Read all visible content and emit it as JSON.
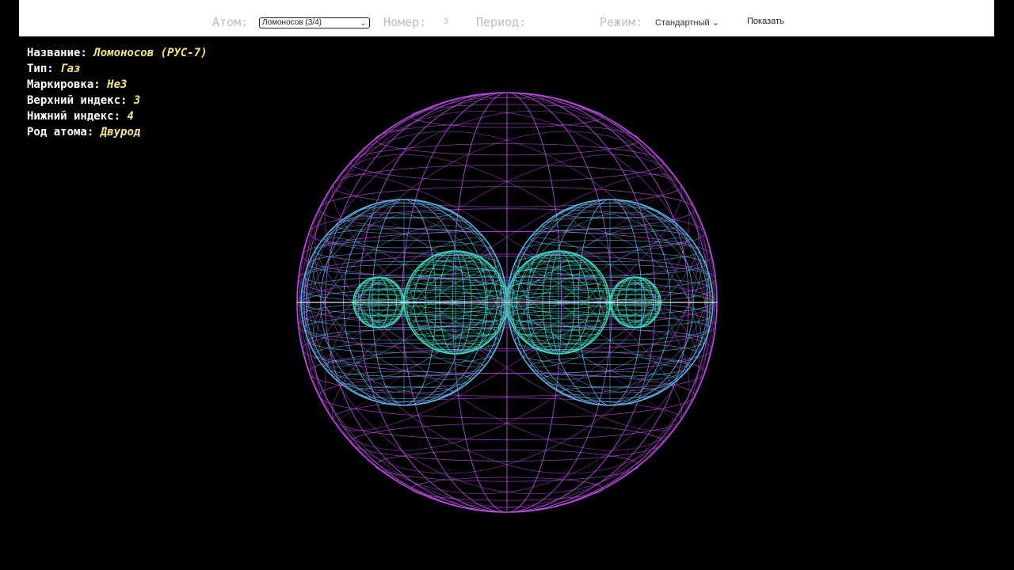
{
  "toolbar": {
    "atom_label": "Атом:",
    "atom_select_value": "Ломоносов (3/4)",
    "number_label": "Номер:",
    "number_value": "3",
    "period_label": "Период:",
    "mode_label": "Режим:",
    "mode_value": "Стандартный",
    "show_button": "Показать"
  },
  "info": {
    "name_label": "Название:",
    "name_value": "Ломоносов (РУС-7)",
    "type_label": "Тип:",
    "type_value": "Газ",
    "marking_label": "Маркировка:",
    "marking_value": "He3",
    "upper_label": "Верхний индекс:",
    "upper_value": "3",
    "lower_label": "Нижний индекс:",
    "lower_value": "4",
    "kind_label": "Род атома:",
    "kind_value": "Двурод"
  },
  "colors": {
    "outer_sphere": "#b84de0",
    "middle_spheres": "#5fb8ee",
    "inner_spheres": "#3fe0c0",
    "value_text": "#f3e58a",
    "label_gray": "#bdbdbd"
  },
  "icons": {
    "select_arrow": "chevron-down-icon"
  }
}
